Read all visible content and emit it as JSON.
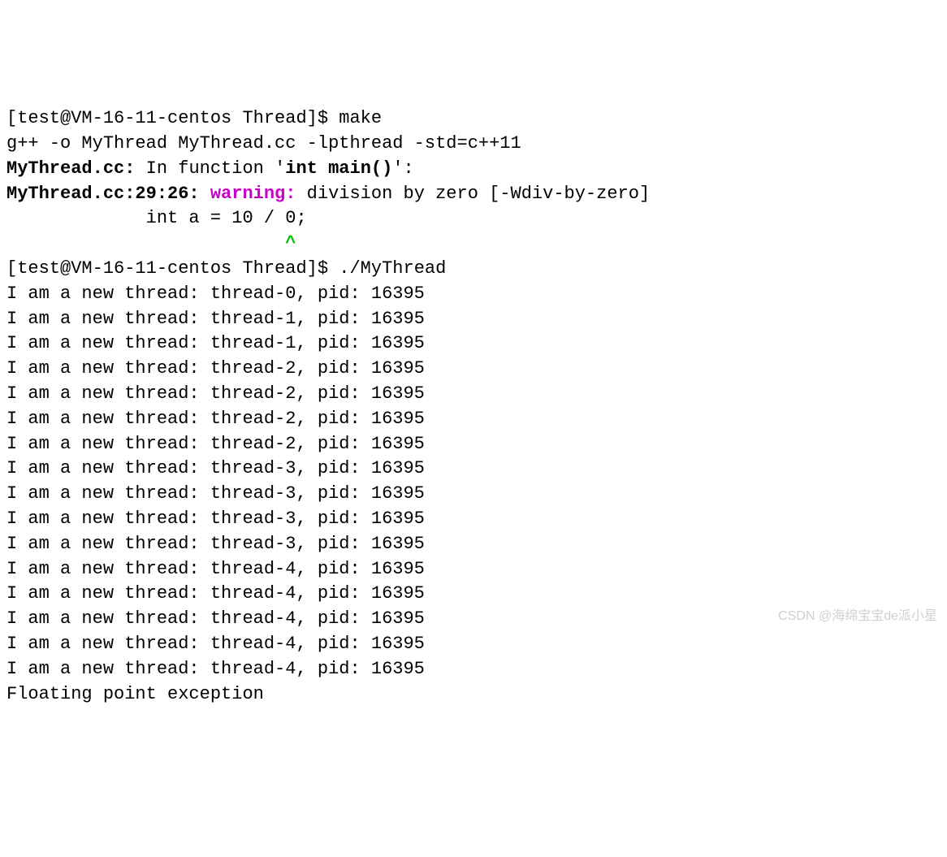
{
  "prompt1": "[test@VM-16-11-centos Thread]$ ",
  "cmd1": "make",
  "compile_line": "g++ -o MyThread MyThread.cc -lpthread -std=c++11",
  "warn_file": "MyThread.cc:",
  "warn_msg1": " In function '",
  "warn_func": "int main()",
  "warn_msg1_end": "':",
  "warn_loc": "MyThread.cc:29:26: ",
  "warn_label": "warning:",
  "warn_text": " division by zero [-Wdiv-by-zero]",
  "code_line": "             int a = 10 / 0;",
  "caret_pad": "                          ",
  "caret": "^",
  "prompt2": "[test@VM-16-11-centos Thread]$ ",
  "cmd2": "./MyThread",
  "thread_prefix": "I am a new thread: thread-",
  "pid_text": ", pid: ",
  "pid_value": "16395",
  "threads": [
    "0",
    "1",
    "1",
    "2",
    "2",
    "2",
    "2",
    "3",
    "3",
    "3",
    "3",
    "4",
    "4",
    "4",
    "4",
    "4"
  ],
  "fpe": "Floating point exception",
  "watermark": "CSDN @海绵宝宝de派小星"
}
